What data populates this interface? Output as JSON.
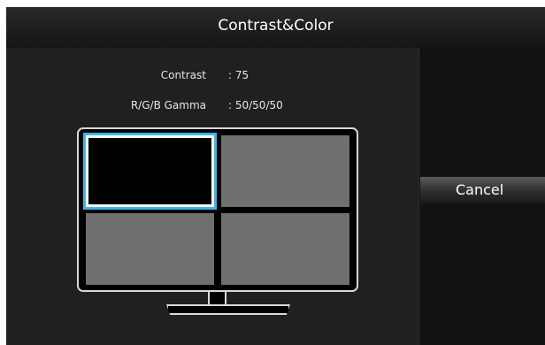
{
  "header": {
    "title": "Contrast&Color"
  },
  "info": {
    "contrast_label": "Contrast",
    "contrast_value": ": 75",
    "gamma_label": "R/G/B Gamma",
    "gamma_value": ": 50/50/50"
  },
  "preview": {
    "selected_cell": 1,
    "cell_count": 4,
    "selection_color": "#3fb4e6",
    "cell_color": "#6f6f6f"
  },
  "actions": {
    "cancel_label": "Cancel"
  },
  "colors": {
    "background": "#1e1e1e",
    "right_panel": "#121212",
    "text": "#ffffff"
  }
}
